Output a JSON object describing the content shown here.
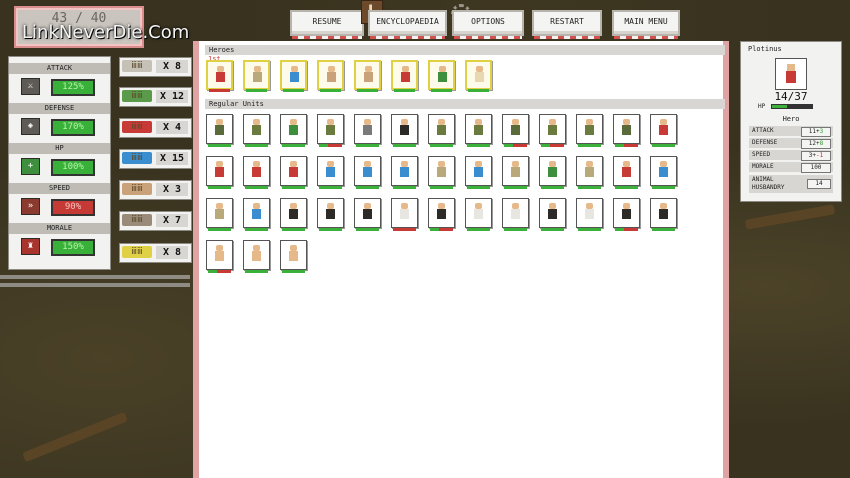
{
  "counter": "43 / 40",
  "watermark": "LinkNeverDie.Com",
  "menu": {
    "resume": "RESUME",
    "encyclopaedia": "ENCYCLOPAEDIA",
    "options": "OPTIONS",
    "restart": "RESTART",
    "main_menu": "MAIN MENU"
  },
  "army_stats": [
    {
      "label": "ATTACK",
      "value": "125%",
      "status": "good"
    },
    {
      "label": "DEFENSE",
      "value": "170%",
      "status": "good"
    },
    {
      "label": "HP",
      "value": "100%",
      "status": "good"
    },
    {
      "label": "SPEED",
      "value": "90%",
      "status": "bad"
    },
    {
      "label": "MORALE",
      "value": "150%",
      "status": "good"
    }
  ],
  "groups": [
    {
      "count": "X 8"
    },
    {
      "count": "X 12"
    },
    {
      "count": "X 4"
    },
    {
      "count": "X 15"
    },
    {
      "count": "X 3"
    },
    {
      "count": "X 7"
    },
    {
      "count": "X 8"
    }
  ],
  "sections": {
    "heroes": "Heroes",
    "regular": "Regular Units",
    "hero_flag": "1st"
  },
  "hero_card": {
    "name": "Plotinus",
    "hp": "14/37",
    "hp_label": "HP",
    "hp_fraction": 0.38,
    "role": "Hero",
    "stats": [
      {
        "label": "ATTACK",
        "base": "11",
        "sign": "+",
        "mod": "3",
        "mod_type": "bonus"
      },
      {
        "label": "DEFENSE",
        "base": "12",
        "sign": "+",
        "mod": "8",
        "mod_type": "bonus"
      },
      {
        "label": "SPEED",
        "base": "3",
        "sign": "+",
        "mod": "-1",
        "mod_type": "malus"
      },
      {
        "label": "MORALE",
        "base": "100",
        "sign": "",
        "mod": "",
        "mod_type": ""
      },
      {
        "label": "ANIMAL HUSBANDRY",
        "base": "14",
        "sign": "",
        "mod": "",
        "mod_type": ""
      }
    ]
  },
  "colors": {
    "good": "#38b03a",
    "bad": "#c63a36",
    "hero_border": "#e0d043",
    "panel_border": "#e0a3a3"
  }
}
